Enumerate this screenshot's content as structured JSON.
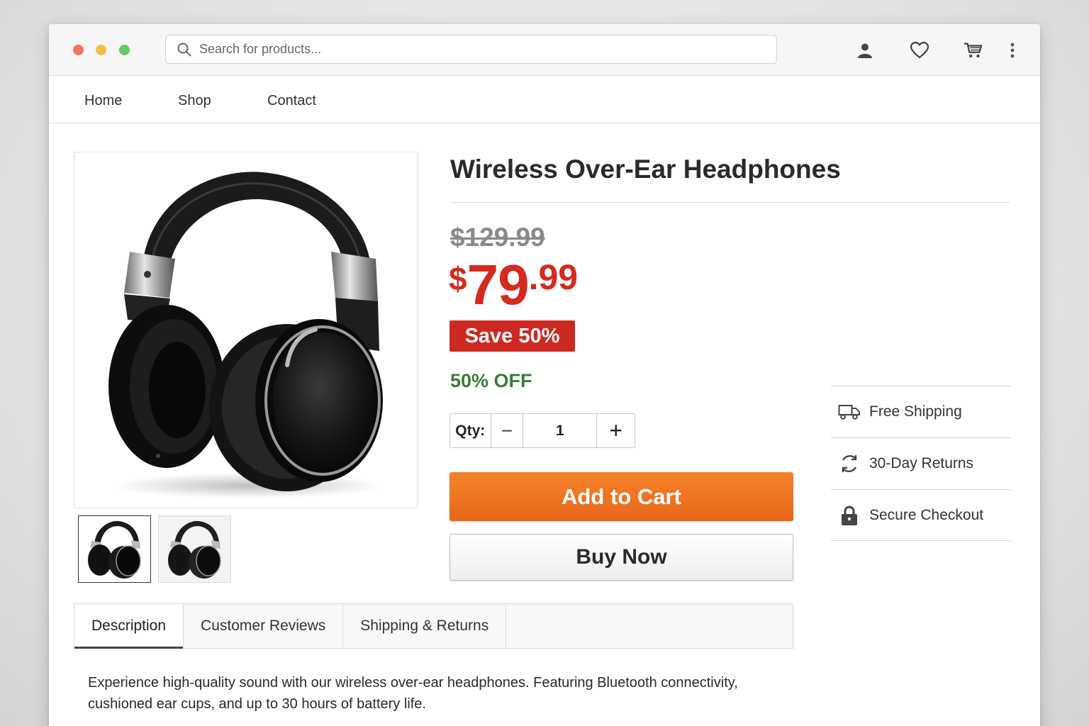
{
  "browser": {
    "search_placeholder": "Search for products..."
  },
  "nav": {
    "items": [
      {
        "label": "Home"
      },
      {
        "label": "Shop"
      },
      {
        "label": "Contact"
      }
    ]
  },
  "product": {
    "title": "Wireless Over-Ear Headphones",
    "old_price": "$129.99",
    "price": {
      "currency": "$",
      "whole": "79",
      "cents": ".99"
    },
    "save_badge": "Save 50%",
    "off_text": "50% OFF",
    "quantity_label": "Qty:",
    "quantity_value": "1",
    "decrement_symbol": "−",
    "increment_symbol": "+",
    "add_to_cart": "Add to Cart",
    "buy_now": "Buy Now"
  },
  "features": [
    {
      "icon": "truck-icon",
      "label": "Free Shipping"
    },
    {
      "icon": "returns-icon",
      "label": "30-Day Returns"
    },
    {
      "icon": "lock-icon",
      "label": "Secure Checkout"
    }
  ],
  "tabs": [
    {
      "label": "Description",
      "active": true
    },
    {
      "label": "Customer Reviews",
      "active": false
    },
    {
      "label": "Shipping & Returns",
      "active": false
    }
  ],
  "description": "Experience high-quality sound with our wireless over-ear headphones. Featuring Bluetooth connectivity, cushioned ear cups, and up to 30 hours of battery life.",
  "colors": {
    "price_red": "#d42b20",
    "badge_red": "#cc2a20",
    "off_green": "#3f7a3f",
    "cart_orange": "#f07824"
  }
}
